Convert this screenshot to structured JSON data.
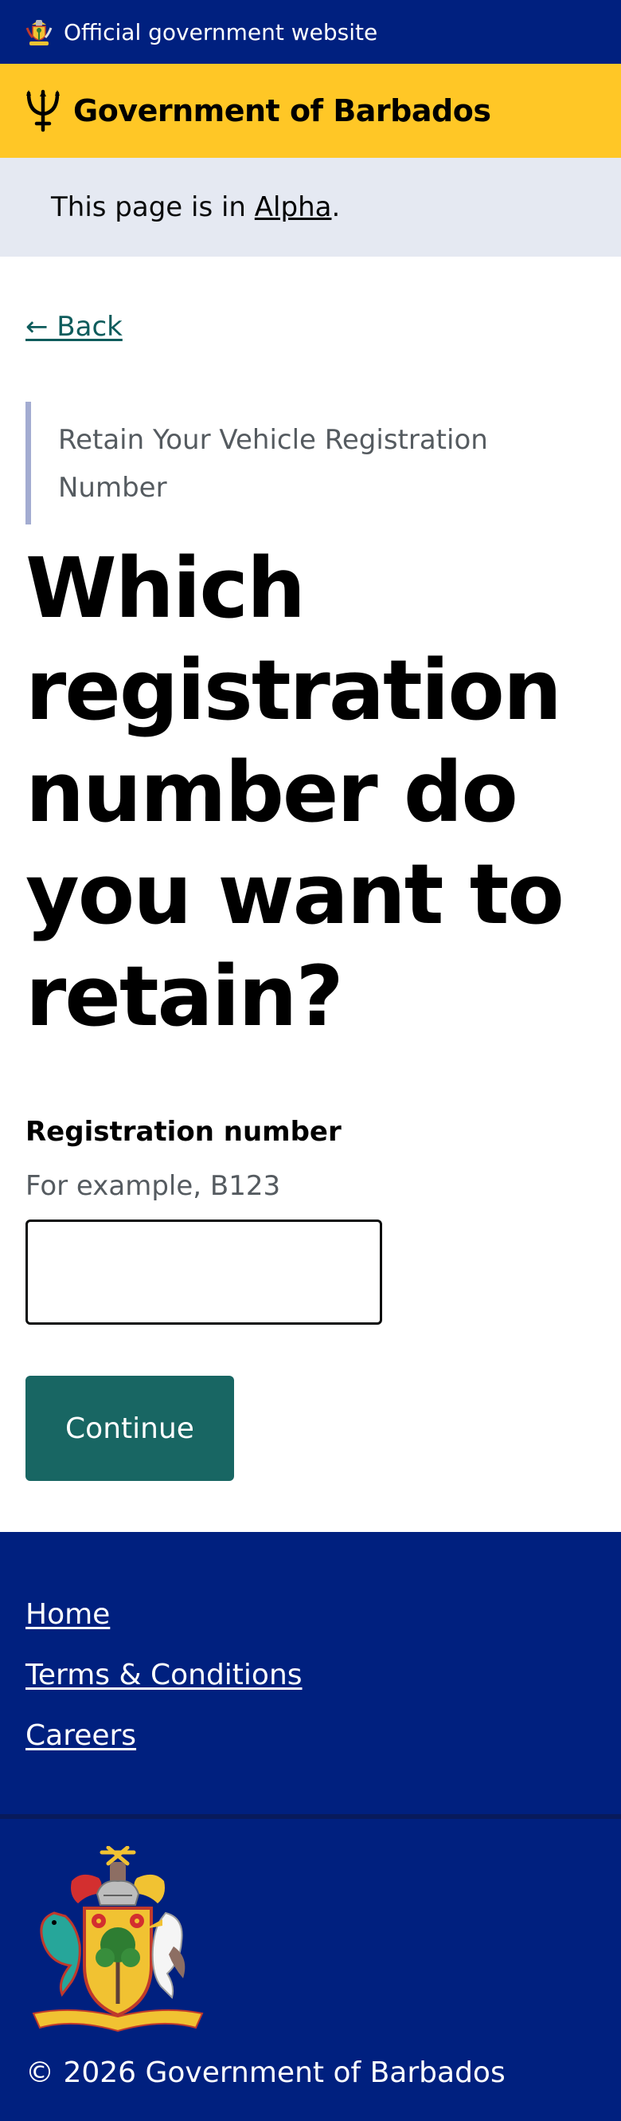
{
  "official_bar": {
    "text": "Official government website"
  },
  "brand": {
    "title": "Government of Barbados"
  },
  "phase_banner": {
    "prefix": "This page is in ",
    "link": "Alpha",
    "suffix": "."
  },
  "back_link": {
    "label": "← Back"
  },
  "caption": "Retain Your Vehicle Registration Number",
  "heading": "Which registration number do you want to retain?",
  "form": {
    "label": "Registration number",
    "hint": "For example, B123",
    "value": "",
    "continue_label": "Continue"
  },
  "footer": {
    "links": [
      {
        "label": "Home"
      },
      {
        "label": "Terms & Conditions"
      },
      {
        "label": "Careers"
      }
    ],
    "copyright": "© 2026 Government of Barbados"
  },
  "colors": {
    "navy": "#00207f",
    "gold": "#ffc726",
    "banner": "#e5e9f2",
    "teal": "#186663",
    "link": "#0e5c5c"
  }
}
